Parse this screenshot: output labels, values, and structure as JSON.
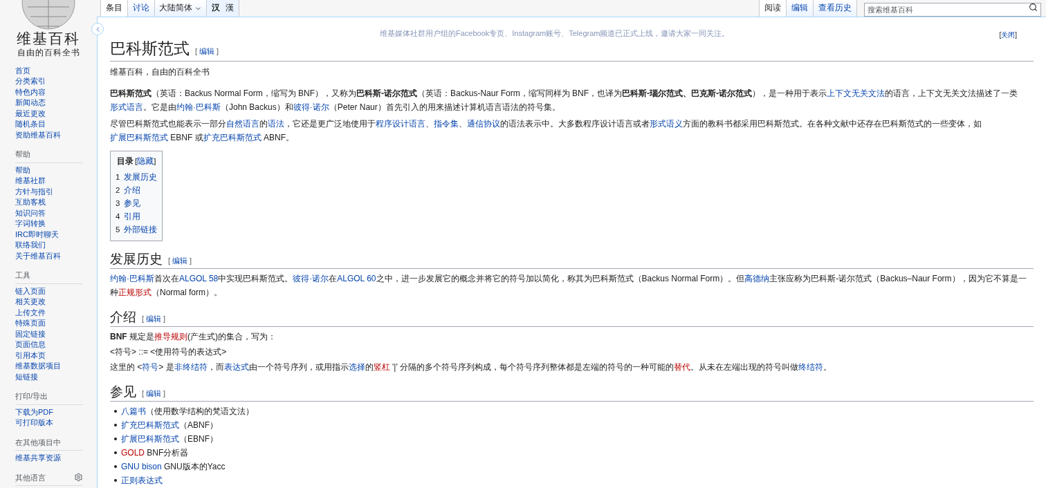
{
  "header": {
    "left_tabs": [
      {
        "label": "条目",
        "selected": true
      },
      {
        "label": "讨论",
        "selected": false
      }
    ],
    "variant": {
      "label": "大陆简体"
    },
    "script_buttons": [
      {
        "label": "汉",
        "selected": true
      },
      {
        "label": "漢",
        "selected": false
      }
    ],
    "right_tabs": [
      {
        "label": "阅读",
        "selected": true
      },
      {
        "label": "编辑",
        "selected": false
      },
      {
        "label": "查看历史",
        "selected": false
      }
    ],
    "search": {
      "placeholder": "搜索维基百科"
    }
  },
  "sidebar": {
    "logo": {
      "title": "维基百科",
      "tagline": "自由的百科全书"
    },
    "nav": [
      "首页",
      "分类索引",
      "特色内容",
      "新闻动态",
      "最近更改",
      "随机条目",
      "资助维基百科"
    ],
    "portals": [
      {
        "heading": "帮助",
        "items": [
          "帮助",
          "维基社群",
          "方针与指引",
          "互助客栈",
          "知识问答",
          "字词转换",
          "IRC即时聊天",
          "联络我们",
          "关于维基百科"
        ]
      },
      {
        "heading": "工具",
        "items": [
          "链入页面",
          "相关更改",
          "上传文件",
          "特殊页面",
          "固定链接",
          "页面信息",
          "引用本页",
          "维基数据项目",
          "短链接"
        ]
      },
      {
        "heading": "打印/导出",
        "items": [
          "下载为PDF",
          "可打印版本"
        ]
      },
      {
        "heading": "在其他项目中",
        "items": [
          "维基共享资源"
        ]
      },
      {
        "heading": "其他语言",
        "kind": "settings"
      }
    ]
  },
  "banner": {
    "text": "维基媒体社群用户组的Facebook专页、Instagram账号、Telegram频道已正式上线，邀请大家一同关注。",
    "close": {
      "open": "[",
      "label": "关闭",
      "close": "]"
    }
  },
  "article": {
    "title": "巴科斯范式",
    "edit": {
      "open": "[",
      "label": "编辑",
      "close": "]"
    },
    "subtitle": "维基百科，自由的百科全书",
    "intro": [
      {
        "kind": "paragraph",
        "segments": [
          {
            "kind": "bold",
            "t": "巴科斯范式"
          },
          {
            "kind": "text",
            "t": "（英语：Backus Normal Form，缩写为 BNF），又称为"
          },
          {
            "kind": "bold",
            "t": "巴科斯-诺尔范式"
          },
          {
            "kind": "text",
            "t": "（英语：Backus-Naur Form，缩写同样为 BNF，也译为"
          },
          {
            "kind": "bold",
            "t": "巴科斯-瑙尔范式、巴克斯-诺尔范式"
          },
          {
            "kind": "text",
            "t": "），是一种用于表示"
          },
          {
            "kind": "link",
            "t": "上下文无关文法"
          },
          {
            "kind": "text",
            "t": "的语言，上下文无关文法描述了一类"
          },
          {
            "kind": "link",
            "t": "形式语言"
          },
          {
            "kind": "text",
            "t": "。它是由"
          },
          {
            "kind": "link",
            "t": "约翰·巴科斯"
          },
          {
            "kind": "text",
            "t": "（John Backus）和"
          },
          {
            "kind": "link",
            "t": "彼得·诺尔"
          },
          {
            "kind": "text",
            "t": "（Peter Naur）首先引入的用来描述计算机语言语法的符号集。"
          }
        ]
      },
      {
        "kind": "paragraph",
        "segments": [
          {
            "kind": "text",
            "t": "尽管巴科斯范式也能表示一部分"
          },
          {
            "kind": "link",
            "t": "自然语言"
          },
          {
            "kind": "text",
            "t": "的"
          },
          {
            "kind": "link",
            "t": "语法"
          },
          {
            "kind": "text",
            "t": "，它还是更广泛地使用于"
          },
          {
            "kind": "link",
            "t": "程序设计语言"
          },
          {
            "kind": "text",
            "t": "、"
          },
          {
            "kind": "link",
            "t": "指令集"
          },
          {
            "kind": "text",
            "t": "、"
          },
          {
            "kind": "link",
            "t": "通信协议"
          },
          {
            "kind": "text",
            "t": "的语法表示中。大多数程序设计语言或者"
          },
          {
            "kind": "link",
            "t": "形式语义"
          },
          {
            "kind": "text",
            "t": "方面的教科书都采用巴科斯范式。在各种文献中还存在巴科斯范式的一些变体，如"
          },
          {
            "kind": "link",
            "t": "扩展巴科斯范式"
          },
          {
            "kind": "text",
            "t": " EBNF 或"
          },
          {
            "kind": "link",
            "t": "扩充巴科斯范式"
          },
          {
            "kind": "text",
            "t": " ABNF。"
          }
        ]
      }
    ],
    "toc": {
      "title": "目录",
      "toggle": {
        "open": "[",
        "label": "隐藏",
        "close": "]"
      },
      "items": [
        {
          "number": "1",
          "label": "发展历史"
        },
        {
          "number": "2",
          "label": "介绍"
        },
        {
          "number": "3",
          "label": "参见"
        },
        {
          "number": "4",
          "label": "引用"
        },
        {
          "number": "5",
          "label": "外部链接"
        }
      ]
    },
    "sections": [
      {
        "title": "发展历史",
        "edit": {
          "open": "[",
          "label": "编辑",
          "close": "]"
        },
        "blocks": [
          {
            "kind": "paragraph",
            "segments": [
              {
                "kind": "link",
                "t": "约翰·巴科斯"
              },
              {
                "kind": "text",
                "t": "首次在"
              },
              {
                "kind": "link",
                "t": "ALGOL 58"
              },
              {
                "kind": "text",
                "t": "中实现巴科斯范式。"
              },
              {
                "kind": "link",
                "t": "彼得·诺尔"
              },
              {
                "kind": "text",
                "t": "在"
              },
              {
                "kind": "link",
                "t": "ALGOL 60"
              },
              {
                "kind": "text",
                "t": "之中，进一步发展它的概念并将它的符号加以简化，称其为巴科斯范式（Backus Normal Form）。但"
              },
              {
                "kind": "link",
                "t": "高德纳"
              },
              {
                "kind": "text",
                "t": "主张应称为巴科斯-诺尔范式（Backus–Naur Form），因为它不算是一种"
              },
              {
                "kind": "redlink",
                "t": "正规形式"
              },
              {
                "kind": "text",
                "t": "（Normal form）。"
              }
            ]
          }
        ]
      },
      {
        "title": "介绍",
        "edit": {
          "open": "[",
          "label": "编辑",
          "close": "]"
        },
        "blocks": [
          {
            "kind": "paragraph",
            "segments": [
              {
                "kind": "bold",
                "t": "BNF"
              },
              {
                "kind": "text",
                "t": " 规定是"
              },
              {
                "kind": "redlink",
                "t": "推导规则"
              },
              {
                "kind": "text",
                "t": "(产生式)的集合，写为："
              }
            ]
          },
          {
            "kind": "paragraph",
            "segments": [
              {
                "kind": "text",
                "t": "<符号> ::= <使用符号的表达式>"
              }
            ]
          },
          {
            "kind": "paragraph",
            "segments": [
              {
                "kind": "text",
                "t": "这里的 <"
              },
              {
                "kind": "link",
                "t": "符号"
              },
              {
                "kind": "text",
                "t": "> 是"
              },
              {
                "kind": "link",
                "t": "非终结符"
              },
              {
                "kind": "text",
                "t": "，而"
              },
              {
                "kind": "link",
                "t": "表达式"
              },
              {
                "kind": "text",
                "t": "由一个符号序列，或用指示"
              },
              {
                "kind": "link",
                "t": "选择"
              },
              {
                "kind": "text",
                "t": "的"
              },
              {
                "kind": "redlink",
                "t": "竖杠"
              },
              {
                "kind": "text",
                "t": " '|' 分隔的多个符号序列构成，每个符号序列整体都是左端的符号的一种可能的"
              },
              {
                "kind": "redlink",
                "t": "替代"
              },
              {
                "kind": "text",
                "t": "。从未在左端出现的符号叫做"
              },
              {
                "kind": "link",
                "t": "终结符"
              },
              {
                "kind": "text",
                "t": "。"
              }
            ]
          }
        ]
      },
      {
        "title": "参见",
        "edit": {
          "open": "[",
          "label": "编辑",
          "close": "]"
        },
        "blocks": [
          {
            "kind": "list",
            "items": [
              [
                {
                  "kind": "link",
                  "t": "八篇书"
                },
                {
                  "kind": "text",
                  "t": "（使用数学结构的梵语文法）"
                }
              ],
              [
                {
                  "kind": "link",
                  "t": "扩充巴科斯范式"
                },
                {
                  "kind": "text",
                  "t": "（ABNF）"
                }
              ],
              [
                {
                  "kind": "link",
                  "t": "扩展巴科斯范式"
                },
                {
                  "kind": "text",
                  "t": "（EBNF）"
                }
              ],
              [
                {
                  "kind": "redlink",
                  "t": "GOLD"
                },
                {
                  "kind": "text",
                  "t": " BNF分析器"
                }
              ],
              [
                {
                  "kind": "link",
                  "t": "GNU bison"
                },
                {
                  "kind": "text",
                  "t": " GNU版本的Yacc"
                }
              ],
              [
                {
                  "kind": "link",
                  "t": "正则表达式"
                }
              ]
            ]
          }
        ]
      }
    ]
  }
}
